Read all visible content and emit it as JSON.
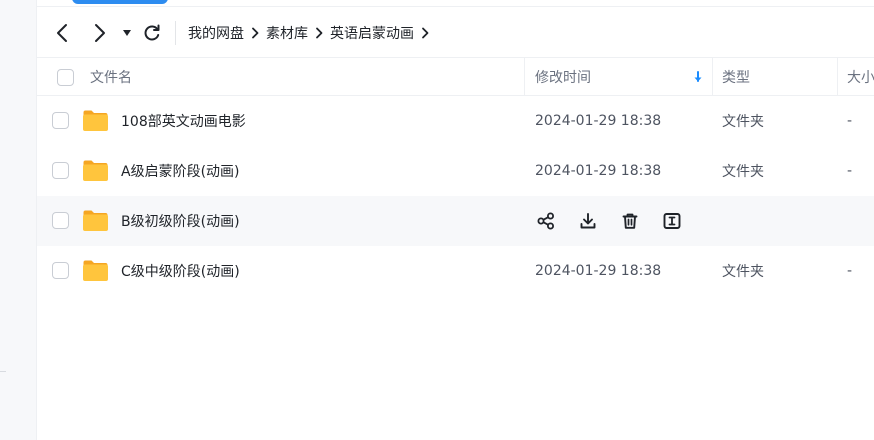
{
  "nav": {
    "back_icon": "chevron-left-icon",
    "forward_icon": "chevron-right-icon",
    "history_icon": "caret-down-icon",
    "refresh_icon": "refresh-icon"
  },
  "breadcrumb": [
    "我的网盘",
    "素材库",
    "英语启蒙动画"
  ],
  "table": {
    "columns": {
      "name": "文件名",
      "modified": "修改时间",
      "type": "类型",
      "size": "大小"
    },
    "sort": {
      "column": "modified",
      "direction": "desc",
      "icon": "sort-arrow-down-icon",
      "color": "#1a8cff"
    },
    "rows": [
      {
        "name": "108部英文动画电影",
        "modified": "2024-01-29 18:38",
        "type": "文件夹",
        "size": "-"
      },
      {
        "name": "A级启蒙阶段(动画)",
        "modified": "2024-01-29 18:38",
        "type": "文件夹",
        "size": "-"
      },
      {
        "name": "B级初级阶段(动画)",
        "hovered": true,
        "actions": [
          "share-icon",
          "download-icon",
          "delete-icon",
          "rename-icon"
        ]
      },
      {
        "name": "C级中级阶段(动画)",
        "modified": "2024-01-29 18:38",
        "type": "文件夹",
        "size": "-"
      }
    ]
  },
  "colors": {
    "folder": "#ffc53d",
    "accent": "#1a8cff",
    "hover_row": "#f7f8fa"
  }
}
